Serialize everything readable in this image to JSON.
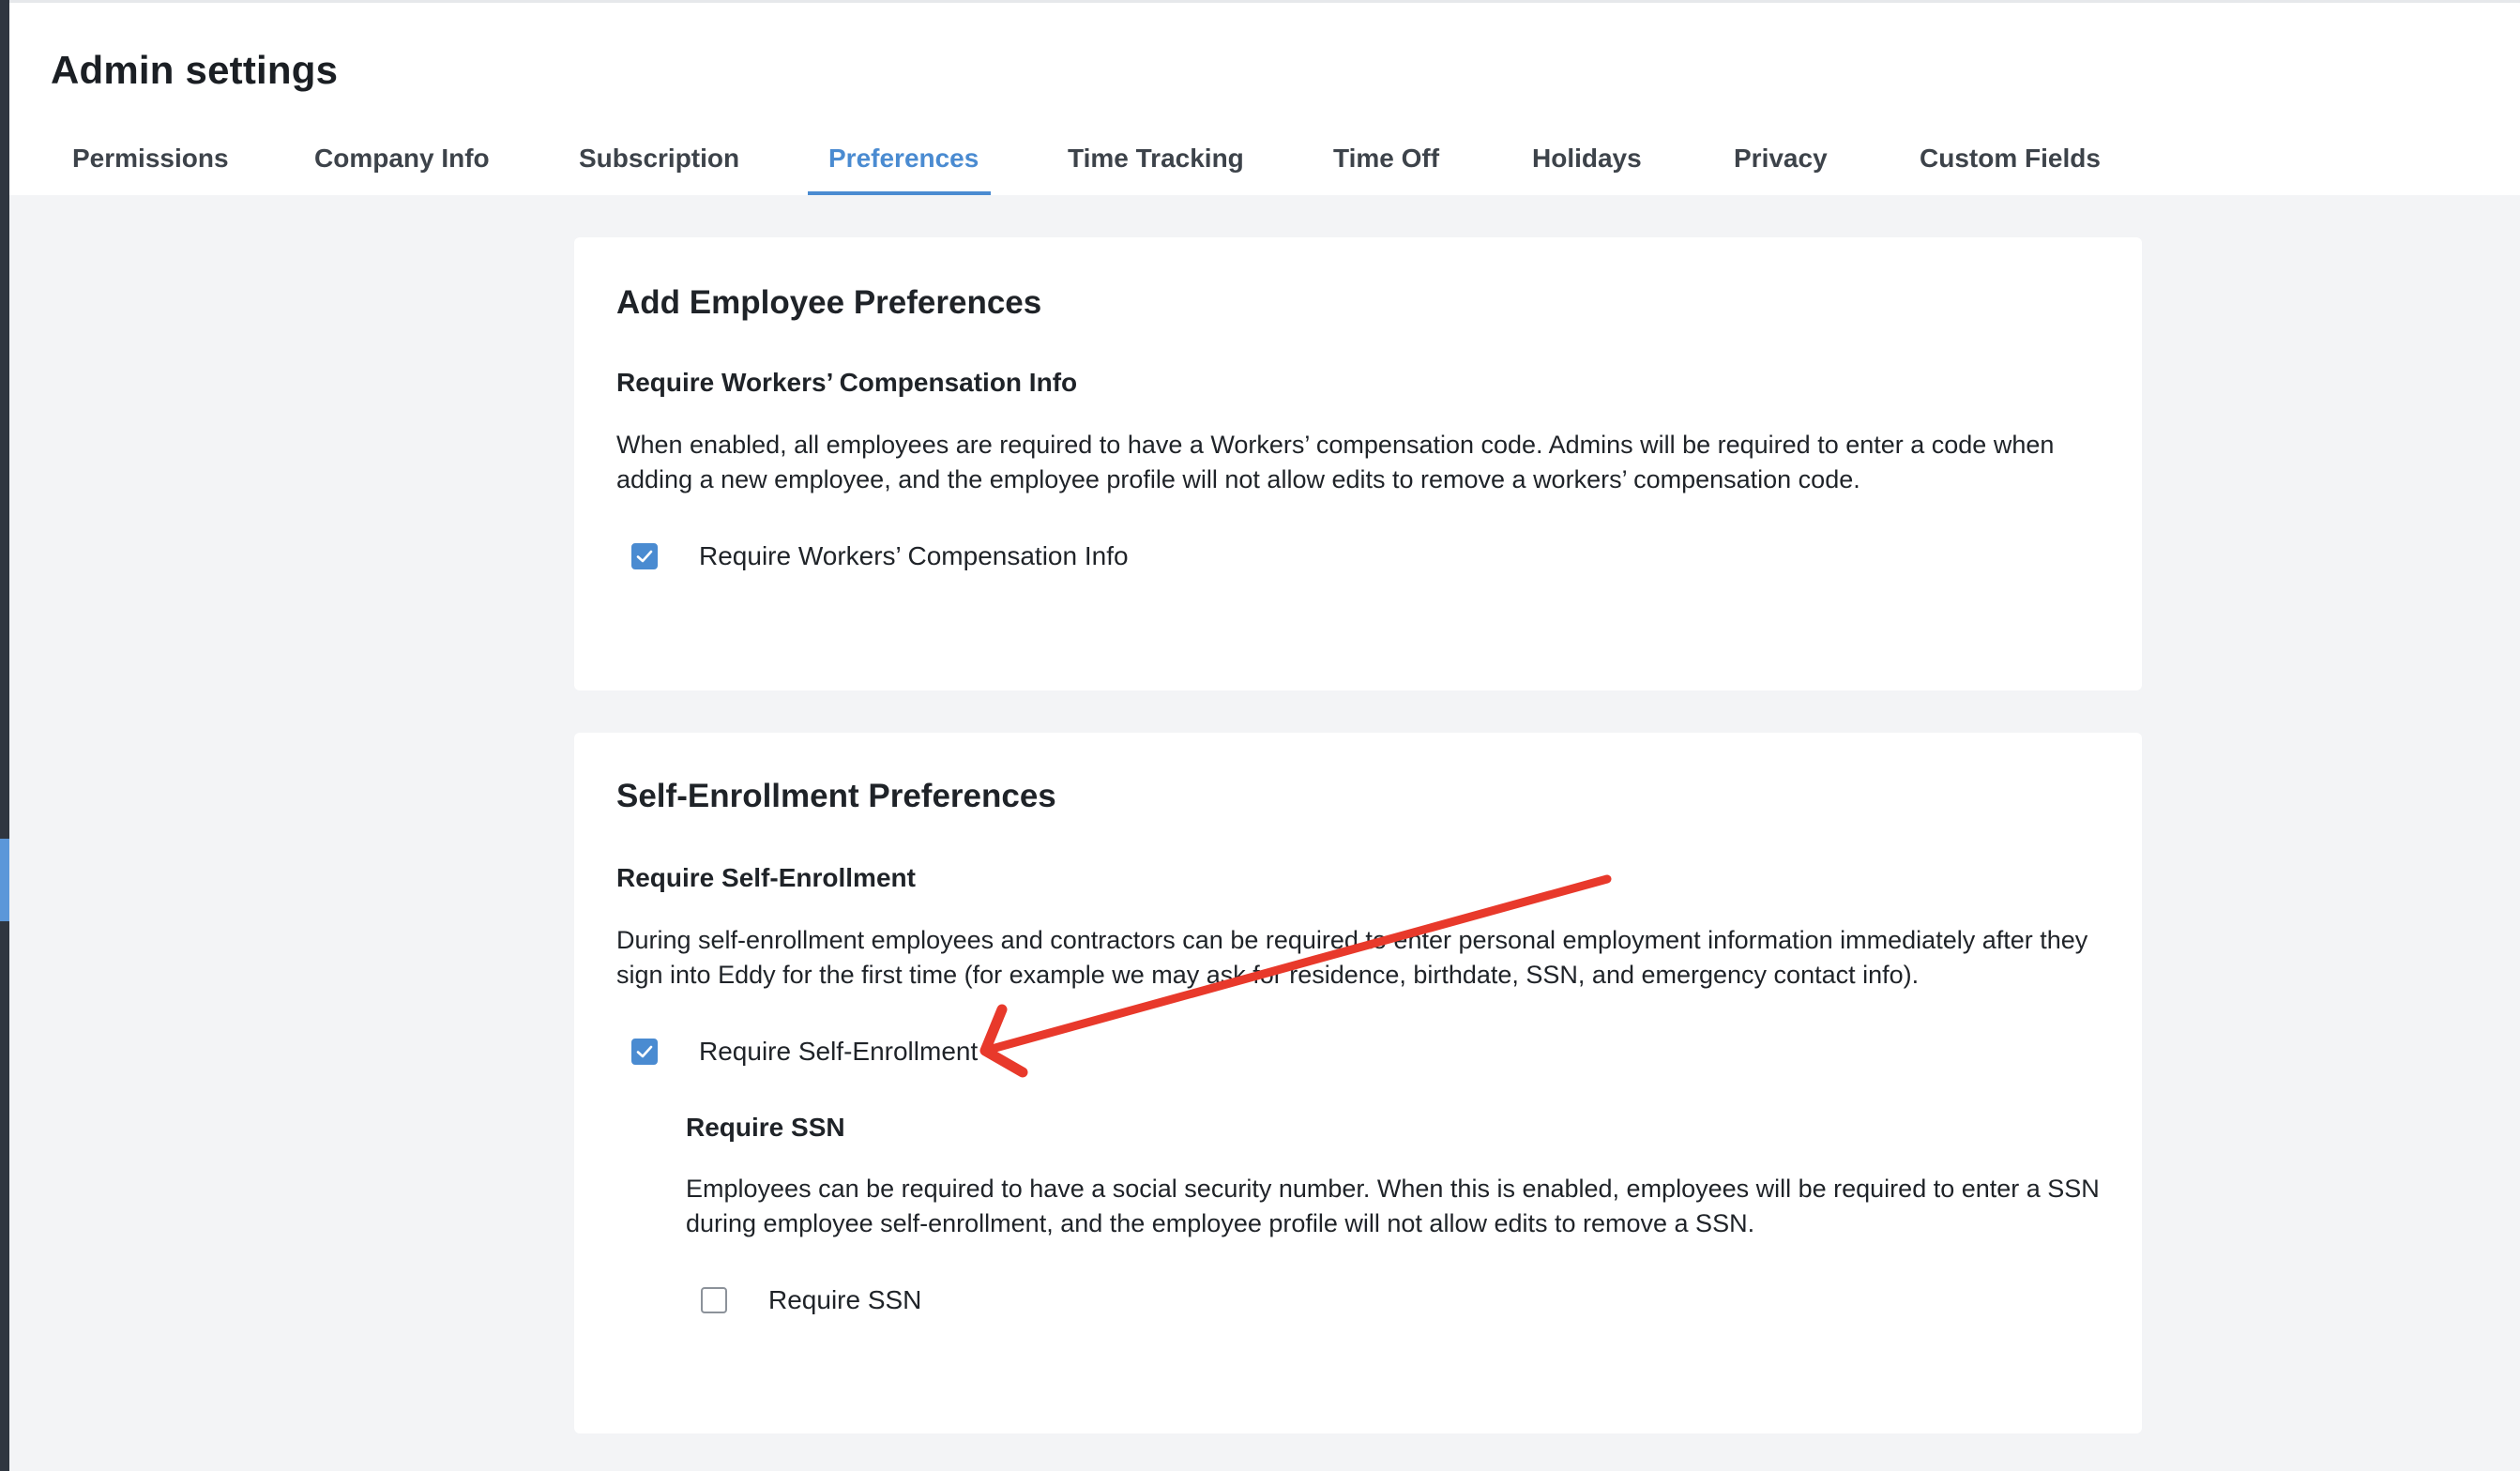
{
  "page": {
    "title": "Admin settings",
    "accent_color": "#4a8bd1"
  },
  "tabs": [
    {
      "label": "Permissions",
      "active": false
    },
    {
      "label": "Company Info",
      "active": false
    },
    {
      "label": "Subscription",
      "active": false
    },
    {
      "label": "Preferences",
      "active": true
    },
    {
      "label": "Time Tracking",
      "active": false
    },
    {
      "label": "Time Off",
      "active": false
    },
    {
      "label": "Holidays",
      "active": false
    },
    {
      "label": "Privacy",
      "active": false
    },
    {
      "label": "Custom Fields",
      "active": false
    }
  ],
  "add_employee": {
    "title": "Add Employee Preferences",
    "workers_comp": {
      "heading": "Require Workers’ Compensation Info",
      "description": "When enabled, all employees are required to have a Workers’ compensation code. Admins will be required to enter a code when adding a new employee, and the employee profile will not allow edits to remove a workers’ compensation code.",
      "checkbox_label": "Require Workers’ Compensation Info",
      "checked": true
    }
  },
  "self_enrollment": {
    "title": "Self-Enrollment Preferences",
    "require_self_enrollment": {
      "heading": "Require Self-Enrollment",
      "description": "During self-enrollment employees and contractors can be required to enter personal employment information immediately after they sign into Eddy for the first time (for example we may ask for residence, birthdate, SSN, and emergency contact info).",
      "checkbox_label": "Require Self-Enrollment",
      "checked": true
    },
    "require_ssn": {
      "heading": "Require SSN",
      "description": "Employees can be required to have a social security number. When this is enabled, employees will be required to enter a SSN during employee self-enrollment, and the employee profile will not allow edits to remove a SSN.",
      "checkbox_label": "Require SSN",
      "checked": false
    }
  },
  "annotation": {
    "arrow_color": "#e8392b"
  }
}
